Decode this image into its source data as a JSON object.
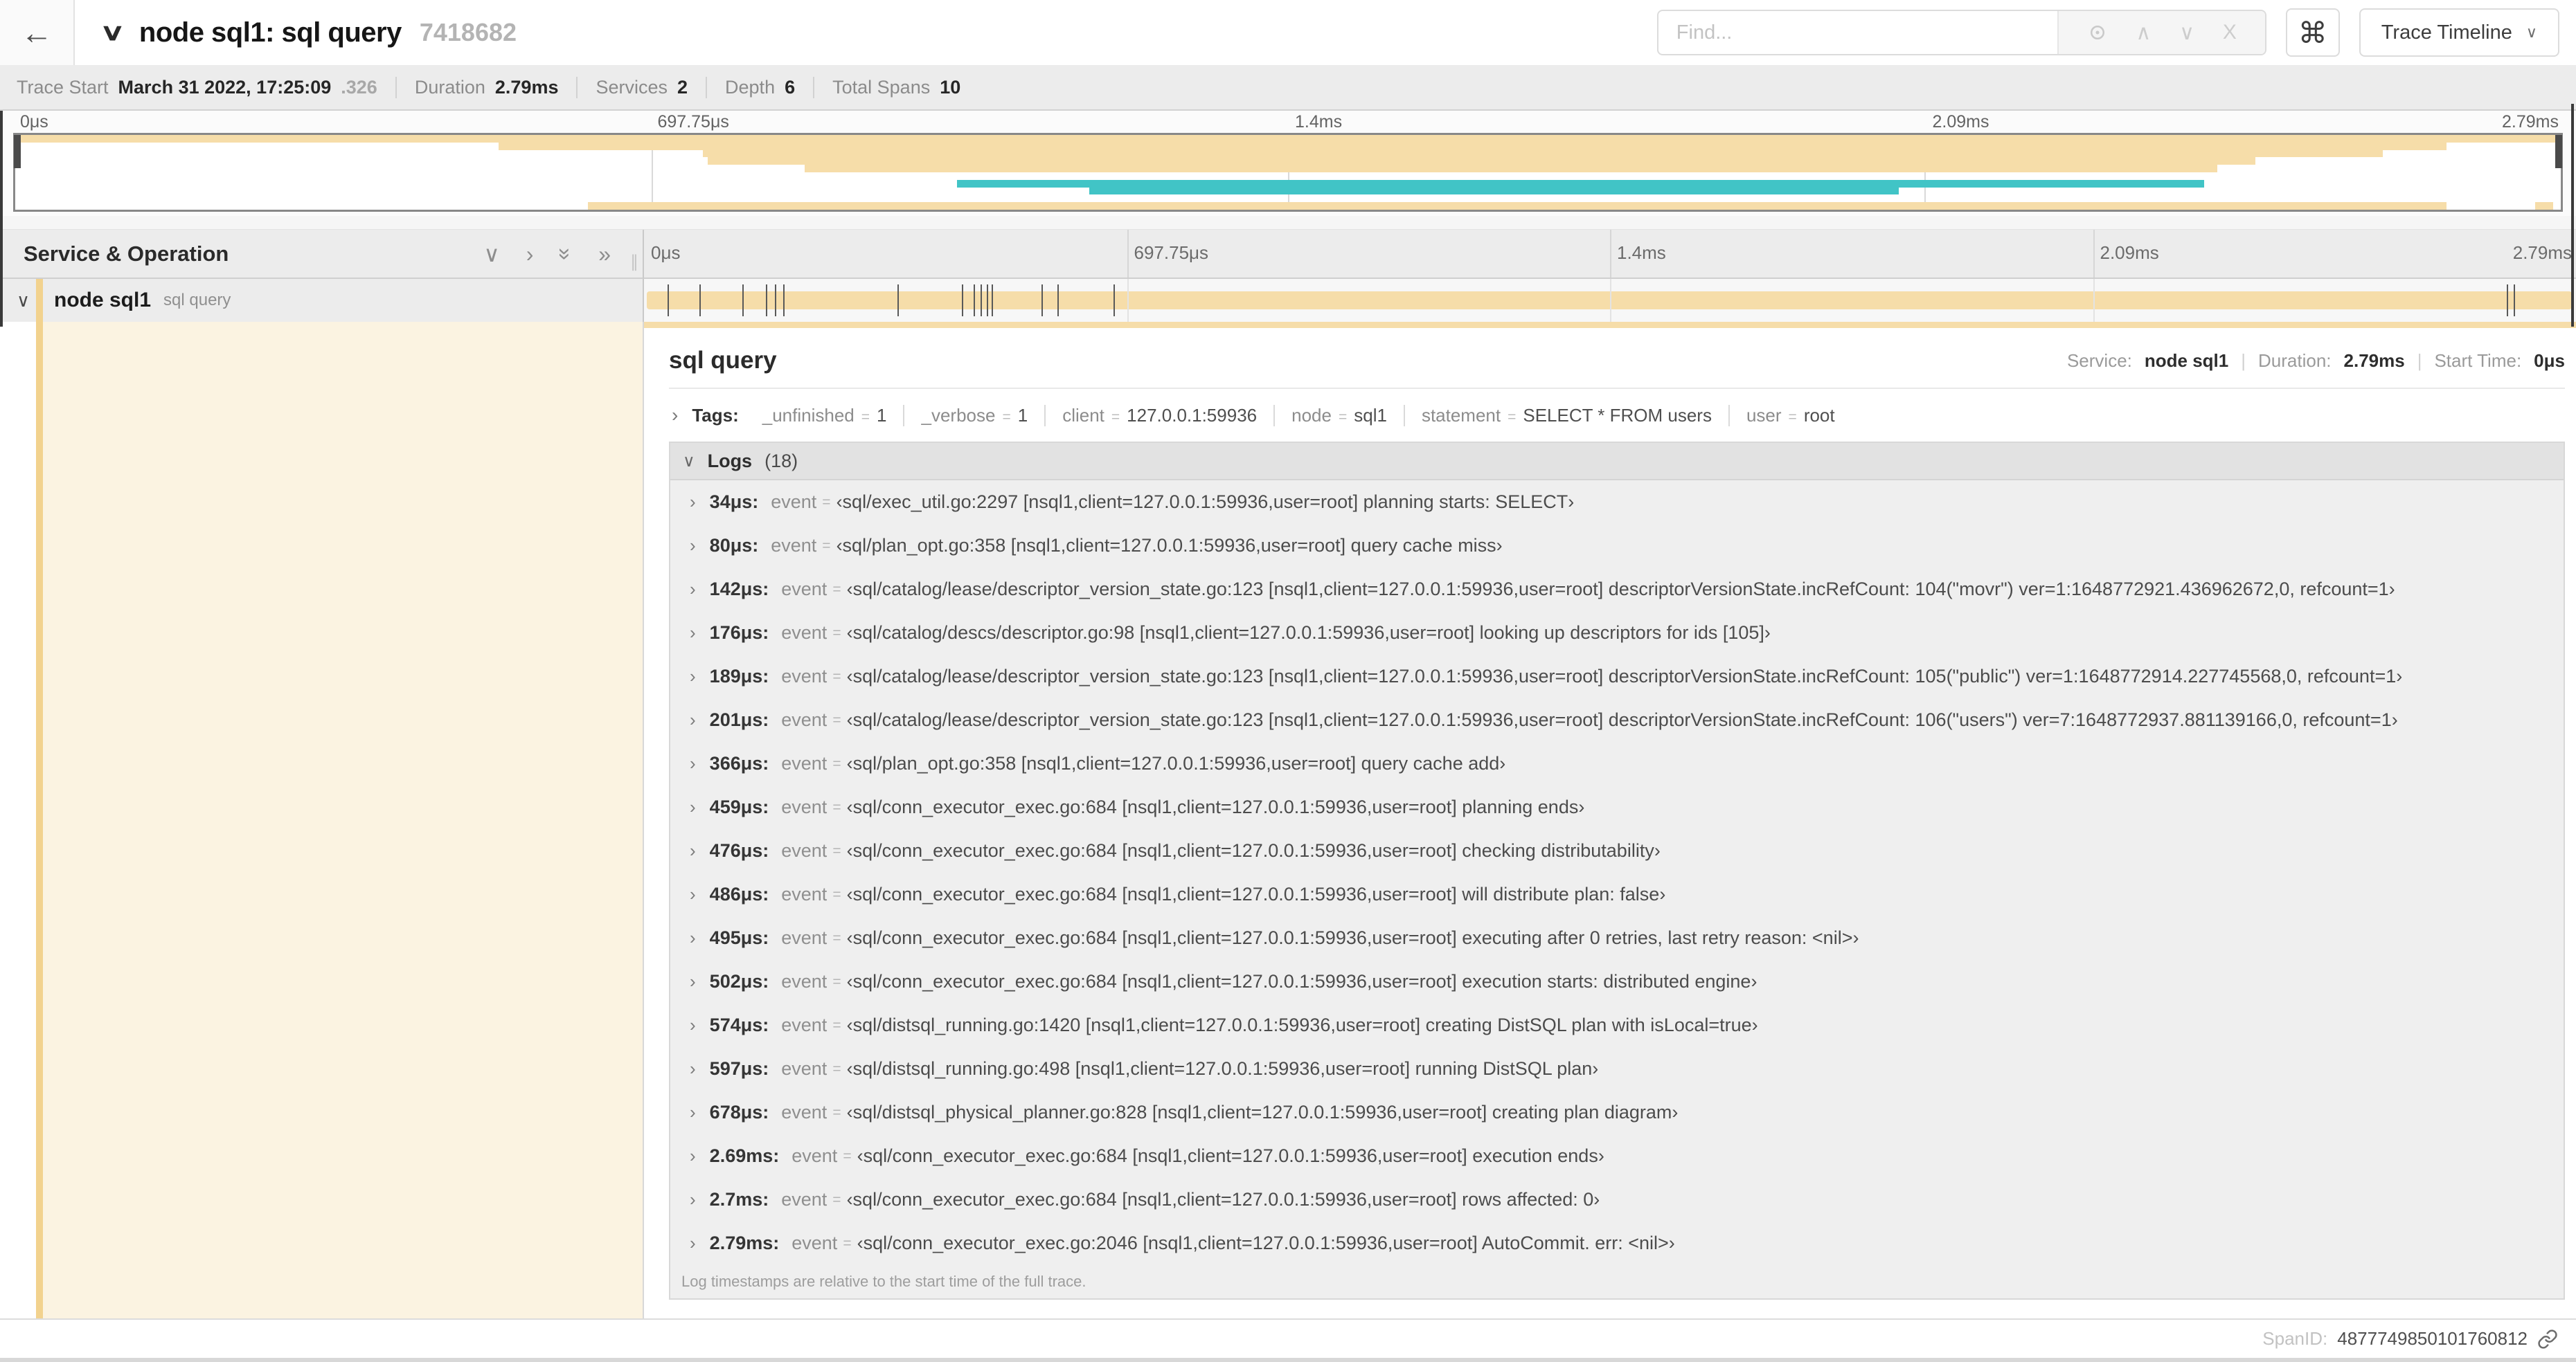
{
  "icons": {
    "back_arrow": "←",
    "chevron_down": "∨",
    "chevron_up": "∧",
    "chevron_right": "›",
    "double_chevron_right": "»",
    "close_x": "X",
    "command": "⌘",
    "drag_handle": "∥"
  },
  "header": {
    "title": "node sql1: sql query",
    "trace_id_short": "7418682",
    "find_placeholder": "Find...",
    "view_button_label": "Trace Timeline"
  },
  "meta": {
    "items": [
      {
        "label": "Trace Start",
        "value": "March 31 2022, 17:25:09",
        "suffix": ".326"
      },
      {
        "label": "Duration",
        "value": "2.79ms",
        "suffix": ""
      },
      {
        "label": "Services",
        "value": "2",
        "suffix": ""
      },
      {
        "label": "Depth",
        "value": "6",
        "suffix": ""
      },
      {
        "label": "Total Spans",
        "value": "10",
        "suffix": ""
      }
    ]
  },
  "colors": {
    "tan": "#f6dda9",
    "teal": "#41c4c6",
    "amber": "#f2d28e",
    "cream": "#fbf3e1"
  },
  "timeline": {
    "tick_labels": [
      "0μs",
      "697.75μs",
      "1.4ms",
      "2.09ms",
      "2.79ms"
    ],
    "tick_pcts": [
      0,
      25,
      50,
      75,
      100
    ],
    "minimap_rows": 10,
    "minimap_bars": [
      {
        "row": 1,
        "start": 0,
        "end": 100,
        "color": "tan"
      },
      {
        "row": 2,
        "start": 19,
        "end": 95.5,
        "color": "tan"
      },
      {
        "row": 3,
        "start": 27,
        "end": 93,
        "color": "tan"
      },
      {
        "row": 4,
        "start": 27.2,
        "end": 88,
        "color": "tan"
      },
      {
        "row": 5,
        "start": 31,
        "end": 86.5,
        "color": "tan"
      },
      {
        "row": 7,
        "start": 37,
        "end": 86,
        "color": "teal"
      },
      {
        "row": 8,
        "start": 42.2,
        "end": 74,
        "color": "teal"
      },
      {
        "row": 10,
        "start": 22.5,
        "end": 95.5,
        "color": "tan"
      },
      {
        "row": 10,
        "start": 99,
        "end": 99.7,
        "color": "tan"
      }
    ],
    "span_tick_pcts": [
      1.22,
      2.87,
      5.09,
      6.31,
      6.77,
      7.2,
      13.12,
      16.45,
      17.06,
      17.42,
      17.74,
      17.99,
      20.57,
      21.4,
      24.3,
      96.42,
      96.78
    ]
  },
  "left_panel": {
    "header_title": "Service & Operation",
    "row": {
      "service": "node sql1",
      "operation": "sql query"
    }
  },
  "detail": {
    "title": "sql query",
    "service_label": "Service:",
    "service": "node sql1",
    "duration_label": "Duration:",
    "duration": "2.79ms",
    "start_label": "Start Time:",
    "start": "0μs",
    "tags_label": "Tags:",
    "tags": [
      {
        "key": "_unfinished",
        "value": "1"
      },
      {
        "key": "_verbose",
        "value": "1"
      },
      {
        "key": "client",
        "value": "127.0.0.1:59936"
      },
      {
        "key": "node",
        "value": "sql1"
      },
      {
        "key": "statement",
        "value": "SELECT * FROM users"
      },
      {
        "key": "user",
        "value": "root"
      }
    ],
    "logs_label": "Logs",
    "logs_count": "(18)",
    "log_field_key": "event",
    "logs": [
      {
        "t": "34μs:",
        "msg": "‹sql/exec_util.go:2297 [nsql1,client=127.0.0.1:59936,user=root] planning starts: SELECT›"
      },
      {
        "t": "80μs:",
        "msg": "‹sql/plan_opt.go:358 [nsql1,client=127.0.0.1:59936,user=root] query cache miss›"
      },
      {
        "t": "142μs:",
        "msg": "‹sql/catalog/lease/descriptor_version_state.go:123 [nsql1,client=127.0.0.1:59936,user=root] descriptorVersionState.incRefCount: 104(\"movr\") ver=1:1648772921.436962672,0, refcount=1›"
      },
      {
        "t": "176μs:",
        "msg": "‹sql/catalog/descs/descriptor.go:98 [nsql1,client=127.0.0.1:59936,user=root] looking up descriptors for ids [105]›"
      },
      {
        "t": "189μs:",
        "msg": "‹sql/catalog/lease/descriptor_version_state.go:123 [nsql1,client=127.0.0.1:59936,user=root] descriptorVersionState.incRefCount: 105(\"public\") ver=1:1648772914.227745568,0, refcount=1›"
      },
      {
        "t": "201μs:",
        "msg": "‹sql/catalog/lease/descriptor_version_state.go:123 [nsql1,client=127.0.0.1:59936,user=root] descriptorVersionState.incRefCount: 106(\"users\") ver=7:1648772937.881139166,0, refcount=1›"
      },
      {
        "t": "366μs:",
        "msg": "‹sql/plan_opt.go:358 [nsql1,client=127.0.0.1:59936,user=root] query cache add›"
      },
      {
        "t": "459μs:",
        "msg": "‹sql/conn_executor_exec.go:684 [nsql1,client=127.0.0.1:59936,user=root] planning ends›"
      },
      {
        "t": "476μs:",
        "msg": "‹sql/conn_executor_exec.go:684 [nsql1,client=127.0.0.1:59936,user=root] checking distributability›"
      },
      {
        "t": "486μs:",
        "msg": "‹sql/conn_executor_exec.go:684 [nsql1,client=127.0.0.1:59936,user=root] will distribute plan: false›"
      },
      {
        "t": "495μs:",
        "msg": "‹sql/conn_executor_exec.go:684 [nsql1,client=127.0.0.1:59936,user=root] executing after 0 retries, last retry reason: <nil>›"
      },
      {
        "t": "502μs:",
        "msg": "‹sql/conn_executor_exec.go:684 [nsql1,client=127.0.0.1:59936,user=root] execution starts: distributed engine›"
      },
      {
        "t": "574μs:",
        "msg": "‹sql/distsql_running.go:1420 [nsql1,client=127.0.0.1:59936,user=root] creating DistSQL plan with isLocal=true›"
      },
      {
        "t": "597μs:",
        "msg": "‹sql/distsql_running.go:498 [nsql1,client=127.0.0.1:59936,user=root] running DistSQL plan›"
      },
      {
        "t": "678μs:",
        "msg": "‹sql/distsql_physical_planner.go:828 [nsql1,client=127.0.0.1:59936,user=root] creating plan diagram›"
      },
      {
        "t": "2.69ms:",
        "msg": "‹sql/conn_executor_exec.go:684 [nsql1,client=127.0.0.1:59936,user=root] execution ends›"
      },
      {
        "t": "2.7ms:",
        "msg": "‹sql/conn_executor_exec.go:684 [nsql1,client=127.0.0.1:59936,user=root] rows affected: 0›"
      },
      {
        "t": "2.79ms:",
        "msg": "‹sql/conn_executor_exec.go:2046 [nsql1,client=127.0.0.1:59936,user=root] AutoCommit. err: <nil>›"
      }
    ],
    "note": "Log timestamps are relative to the start time of the full trace.",
    "spanid_label": "SpanID:",
    "spanid": "4877749850101760812"
  }
}
